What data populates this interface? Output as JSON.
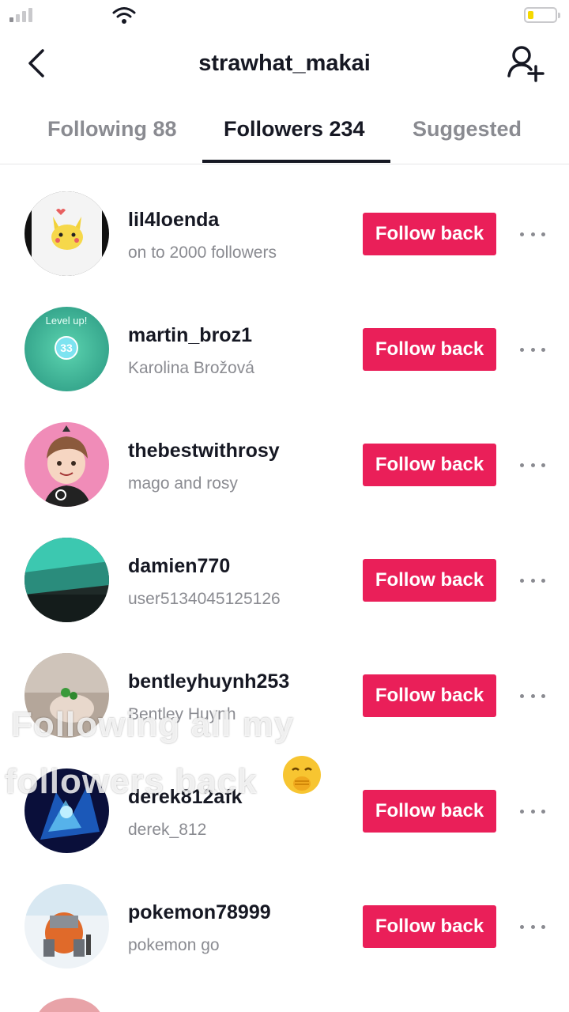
{
  "status_bar": {
    "battery_level": 0.2,
    "battery_color": "#f5d800"
  },
  "header": {
    "title": "strawhat_makai",
    "back_icon": "chevron-left-icon",
    "add_user_icon": "add-user-icon"
  },
  "tabs": [
    {
      "label": "Following 88",
      "active": false
    },
    {
      "label": "Followers 234",
      "active": true
    },
    {
      "label": "Suggested",
      "active": false
    }
  ],
  "followers": [
    {
      "username": "lil4loenda",
      "subtitle": "on to 2000 followers",
      "button": "Follow back"
    },
    {
      "username": "martin_broz1",
      "subtitle": "Karolina Brožová",
      "button": "Follow back"
    },
    {
      "username": "thebestwithrosy",
      "subtitle": "mago and rosy",
      "button": "Follow back"
    },
    {
      "username": "damien770",
      "subtitle": "user5134045125126",
      "button": "Follow back"
    },
    {
      "username": "bentleyhuynh253",
      "subtitle": "Bentley Huynh",
      "button": "Follow back"
    },
    {
      "username": "derek812afk",
      "subtitle": "derek_812",
      "button": "Follow back"
    },
    {
      "username": "pokemon78999",
      "subtitle": "pokemon go",
      "button": "Follow back"
    }
  ],
  "avatar_text": {
    "martin_broz1": {
      "top": "Level up!",
      "badge": "33"
    }
  },
  "overlay_caption": {
    "line1": "Following all my",
    "line2": "followers back",
    "emoji": "face-with-hand-over-mouth"
  },
  "colors": {
    "accent": "#ea1f59",
    "text_primary": "#161823",
    "text_secondary": "#8a8b91"
  }
}
